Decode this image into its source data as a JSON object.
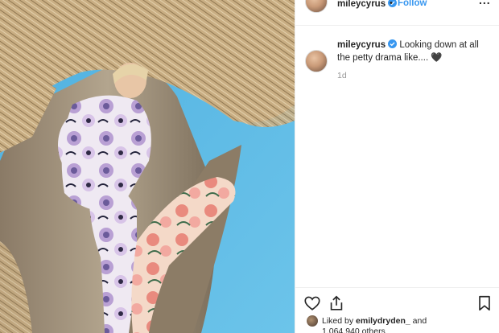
{
  "post": {
    "username": "mileycyrus",
    "follow_label": "Follow",
    "dot": "•",
    "more": "...",
    "caption_text": "Looking down at all the petty drama like.... 🖤",
    "time_ago": "1d"
  },
  "likes": {
    "prefix": "Liked by",
    "user": "emilydryden_",
    "suffix": "and",
    "others": "1,064,940 others"
  },
  "icons": {
    "verified": "verified-badge-icon",
    "like": "heart-icon",
    "share": "share-icon",
    "save": "bookmark-icon"
  },
  "colors": {
    "accent": "#3897f0",
    "sky": "#58b4df",
    "text": "#262626",
    "muted": "#999999"
  }
}
